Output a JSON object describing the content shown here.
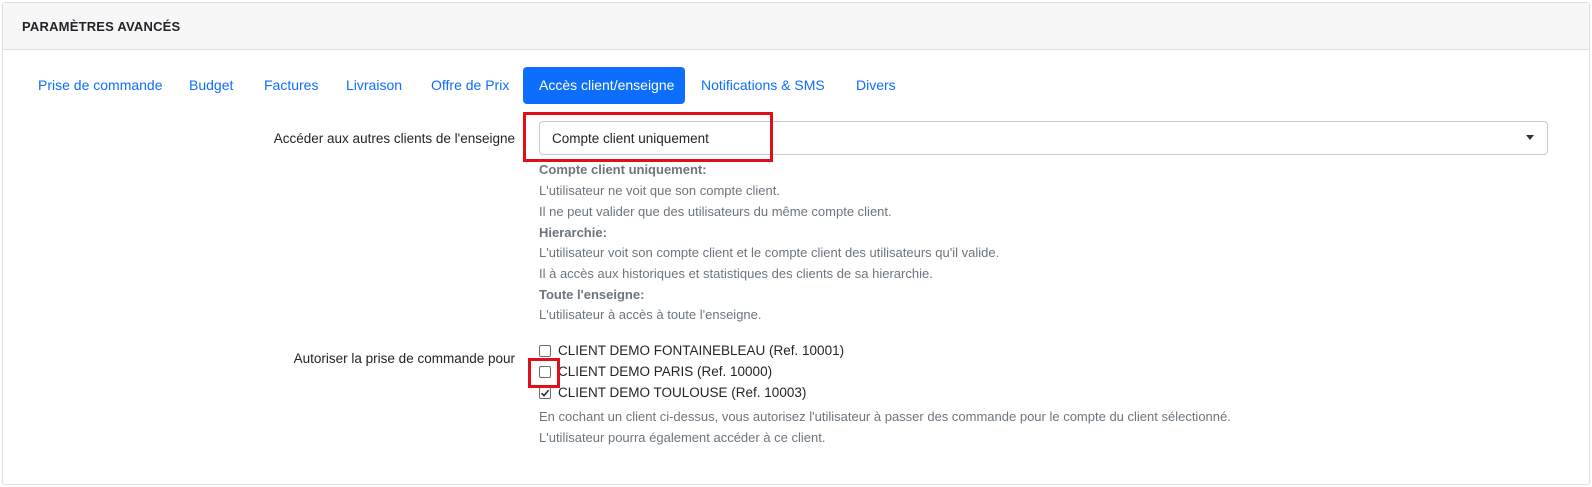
{
  "card": {
    "title": "PARAMÈTRES AVANCÉS"
  },
  "tabs": [
    {
      "label": "Prise de commande",
      "active": false
    },
    {
      "label": "Budget",
      "active": false
    },
    {
      "label": "Factures",
      "active": false
    },
    {
      "label": "Livraison",
      "active": false
    },
    {
      "label": "Offre de Prix",
      "active": false
    },
    {
      "label": "Accès client/enseigne",
      "active": true
    },
    {
      "label": "Notifications & SMS",
      "active": false
    },
    {
      "label": "Divers",
      "active": false
    }
  ],
  "access": {
    "label": "Accéder aux autres clients de l'enseigne",
    "selected": "Compte client uniquement",
    "help": {
      "h1": "Compte client uniquement:",
      "l1": "L'utilisateur ne voit que son compte client.",
      "l2": "Il ne peut valider que des utilisateurs du même compte client.",
      "h2": "Hierarchie:",
      "l3": "L'utilisateur voit son compte client et le compte client des utilisateurs qu'il valide.",
      "l4": "Il à accès aux historiques et statistiques des clients de sa hierarchie.",
      "h3": "Toute l'enseigne:",
      "l5": "L'utilisateur à accès à toute l'enseigne."
    }
  },
  "orders": {
    "label": "Autoriser la prise de commande pour",
    "clients": [
      {
        "label": "CLIENT DEMO FONTAINEBLEAU (Ref. 10001)",
        "checked": false
      },
      {
        "label": "CLIENT DEMO PARIS (Ref. 10000)",
        "checked": false
      },
      {
        "label": "CLIENT DEMO TOULOUSE (Ref. 10003)",
        "checked": true
      }
    ],
    "help1": "En cochant un client ci-dessus, vous autorisez l'utilisateur à passer des commande pour le compte du client sélectionné.",
    "help2": "L'utilisateur pourra également accéder à ce client."
  },
  "colors": {
    "accent": "#0d6efd",
    "annotation": "#e0101a"
  }
}
